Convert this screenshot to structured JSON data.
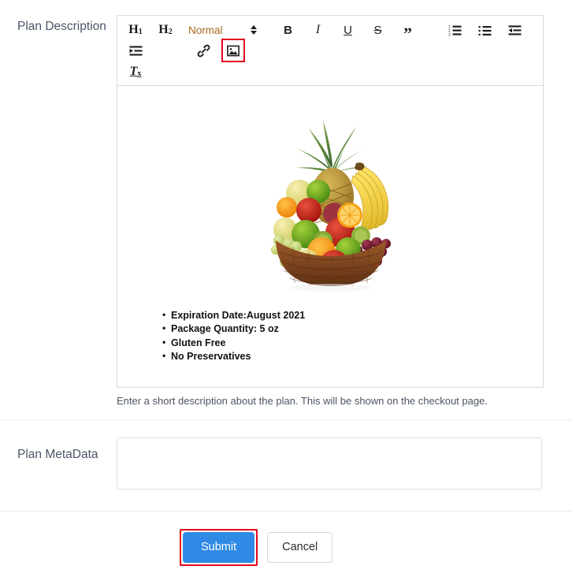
{
  "form": {
    "description_field": {
      "label": "Plan Description",
      "help_text": "Enter a short description about the plan. This will be shown on the checkout page."
    },
    "metadata_field": {
      "label": "Plan MetaData",
      "value": "",
      "placeholder": ""
    }
  },
  "editor": {
    "toolbar": {
      "h1_label": "H",
      "h1_sub": "1",
      "h2_label": "H",
      "h2_sub": "2",
      "format_picker_value": "Normal",
      "format_picker_color": "#a9681d",
      "bold_label": "B",
      "italic_label": "I",
      "underline_label": "U",
      "strike_label": "S",
      "blockquote_label": "”",
      "ordered_list_name": "ordered-list",
      "bullet_list_name": "bullet-list",
      "outdent_name": "outdent",
      "indent_name": "indent",
      "link_name": "link",
      "image_name": "image",
      "clear_format_label": "T",
      "clear_format_sub": "x",
      "highlighted_button": "image",
      "highlight_color": "#e4051e"
    },
    "content": {
      "image_alt": "fruit-basket",
      "bullets": [
        "Expiration Date:August 2021",
        "Package Quantity: 5 oz",
        "Gluten Free",
        "No Preservatives"
      ]
    }
  },
  "actions": {
    "submit_label": "Submit",
    "submit_color": "#2e8ae5",
    "submit_highlight_color": "#e4051e",
    "cancel_label": "Cancel"
  }
}
